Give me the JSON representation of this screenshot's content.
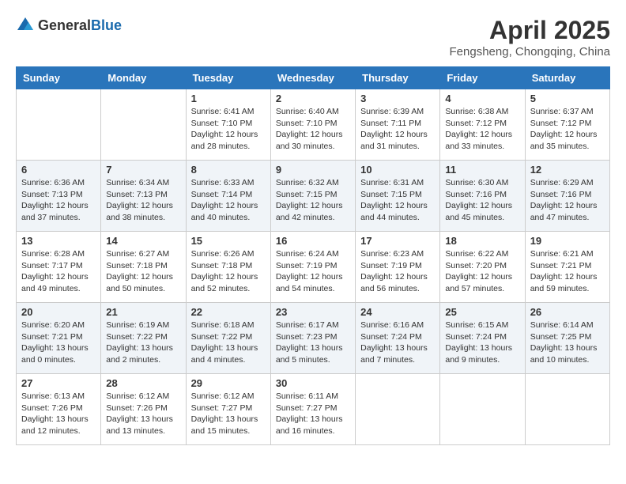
{
  "header": {
    "logo_general": "General",
    "logo_blue": "Blue",
    "month_year": "April 2025",
    "location": "Fengsheng, Chongqing, China"
  },
  "weekdays": [
    "Sunday",
    "Monday",
    "Tuesday",
    "Wednesday",
    "Thursday",
    "Friday",
    "Saturday"
  ],
  "weeks": [
    [
      {
        "day": "",
        "info": ""
      },
      {
        "day": "",
        "info": ""
      },
      {
        "day": "1",
        "info": "Sunrise: 6:41 AM\nSunset: 7:10 PM\nDaylight: 12 hours and 28 minutes."
      },
      {
        "day": "2",
        "info": "Sunrise: 6:40 AM\nSunset: 7:10 PM\nDaylight: 12 hours and 30 minutes."
      },
      {
        "day": "3",
        "info": "Sunrise: 6:39 AM\nSunset: 7:11 PM\nDaylight: 12 hours and 31 minutes."
      },
      {
        "day": "4",
        "info": "Sunrise: 6:38 AM\nSunset: 7:12 PM\nDaylight: 12 hours and 33 minutes."
      },
      {
        "day": "5",
        "info": "Sunrise: 6:37 AM\nSunset: 7:12 PM\nDaylight: 12 hours and 35 minutes."
      }
    ],
    [
      {
        "day": "6",
        "info": "Sunrise: 6:36 AM\nSunset: 7:13 PM\nDaylight: 12 hours and 37 minutes."
      },
      {
        "day": "7",
        "info": "Sunrise: 6:34 AM\nSunset: 7:13 PM\nDaylight: 12 hours and 38 minutes."
      },
      {
        "day": "8",
        "info": "Sunrise: 6:33 AM\nSunset: 7:14 PM\nDaylight: 12 hours and 40 minutes."
      },
      {
        "day": "9",
        "info": "Sunrise: 6:32 AM\nSunset: 7:15 PM\nDaylight: 12 hours and 42 minutes."
      },
      {
        "day": "10",
        "info": "Sunrise: 6:31 AM\nSunset: 7:15 PM\nDaylight: 12 hours and 44 minutes."
      },
      {
        "day": "11",
        "info": "Sunrise: 6:30 AM\nSunset: 7:16 PM\nDaylight: 12 hours and 45 minutes."
      },
      {
        "day": "12",
        "info": "Sunrise: 6:29 AM\nSunset: 7:16 PM\nDaylight: 12 hours and 47 minutes."
      }
    ],
    [
      {
        "day": "13",
        "info": "Sunrise: 6:28 AM\nSunset: 7:17 PM\nDaylight: 12 hours and 49 minutes."
      },
      {
        "day": "14",
        "info": "Sunrise: 6:27 AM\nSunset: 7:18 PM\nDaylight: 12 hours and 50 minutes."
      },
      {
        "day": "15",
        "info": "Sunrise: 6:26 AM\nSunset: 7:18 PM\nDaylight: 12 hours and 52 minutes."
      },
      {
        "day": "16",
        "info": "Sunrise: 6:24 AM\nSunset: 7:19 PM\nDaylight: 12 hours and 54 minutes."
      },
      {
        "day": "17",
        "info": "Sunrise: 6:23 AM\nSunset: 7:19 PM\nDaylight: 12 hours and 56 minutes."
      },
      {
        "day": "18",
        "info": "Sunrise: 6:22 AM\nSunset: 7:20 PM\nDaylight: 12 hours and 57 minutes."
      },
      {
        "day": "19",
        "info": "Sunrise: 6:21 AM\nSunset: 7:21 PM\nDaylight: 12 hours and 59 minutes."
      }
    ],
    [
      {
        "day": "20",
        "info": "Sunrise: 6:20 AM\nSunset: 7:21 PM\nDaylight: 13 hours and 0 minutes."
      },
      {
        "day": "21",
        "info": "Sunrise: 6:19 AM\nSunset: 7:22 PM\nDaylight: 13 hours and 2 minutes."
      },
      {
        "day": "22",
        "info": "Sunrise: 6:18 AM\nSunset: 7:22 PM\nDaylight: 13 hours and 4 minutes."
      },
      {
        "day": "23",
        "info": "Sunrise: 6:17 AM\nSunset: 7:23 PM\nDaylight: 13 hours and 5 minutes."
      },
      {
        "day": "24",
        "info": "Sunrise: 6:16 AM\nSunset: 7:24 PM\nDaylight: 13 hours and 7 minutes."
      },
      {
        "day": "25",
        "info": "Sunrise: 6:15 AM\nSunset: 7:24 PM\nDaylight: 13 hours and 9 minutes."
      },
      {
        "day": "26",
        "info": "Sunrise: 6:14 AM\nSunset: 7:25 PM\nDaylight: 13 hours and 10 minutes."
      }
    ],
    [
      {
        "day": "27",
        "info": "Sunrise: 6:13 AM\nSunset: 7:26 PM\nDaylight: 13 hours and 12 minutes."
      },
      {
        "day": "28",
        "info": "Sunrise: 6:12 AM\nSunset: 7:26 PM\nDaylight: 13 hours and 13 minutes."
      },
      {
        "day": "29",
        "info": "Sunrise: 6:12 AM\nSunset: 7:27 PM\nDaylight: 13 hours and 15 minutes."
      },
      {
        "day": "30",
        "info": "Sunrise: 6:11 AM\nSunset: 7:27 PM\nDaylight: 13 hours and 16 minutes."
      },
      {
        "day": "",
        "info": ""
      },
      {
        "day": "",
        "info": ""
      },
      {
        "day": "",
        "info": ""
      }
    ]
  ]
}
